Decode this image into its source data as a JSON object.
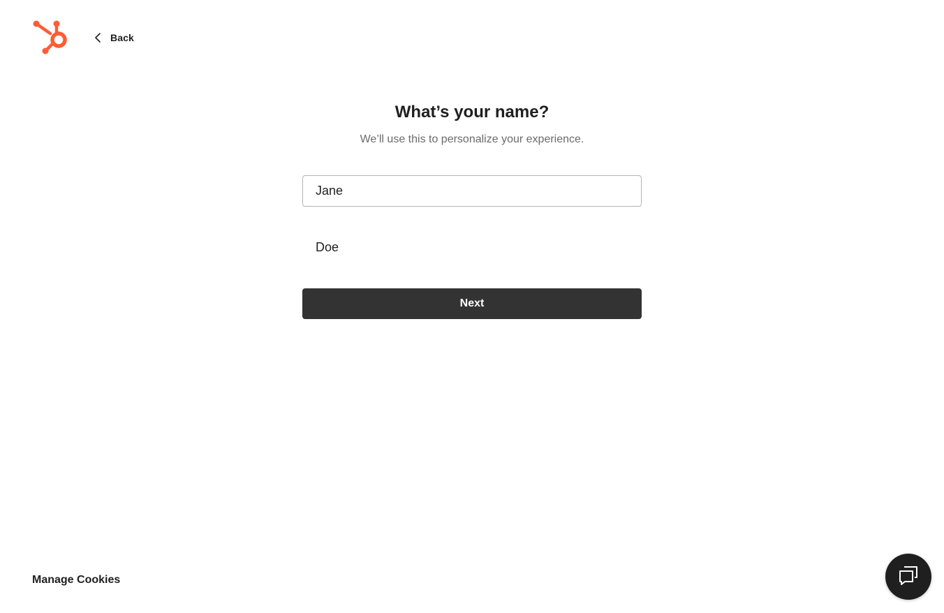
{
  "brand": {
    "logo_icon": "hubspot-sprocket-icon",
    "accent_color": "#ff5c35"
  },
  "nav": {
    "back_label": "Back",
    "back_icon": "chevron-left-icon"
  },
  "form": {
    "title": "What’s your name?",
    "subtitle": "We’ll use this to personalize your experience.",
    "first_name_value": "Jane",
    "last_name_value": "Doe",
    "next_label": "Next"
  },
  "footer": {
    "manage_cookies_label": "Manage Cookies"
  },
  "chat": {
    "icon": "chat-bubbles-icon"
  }
}
